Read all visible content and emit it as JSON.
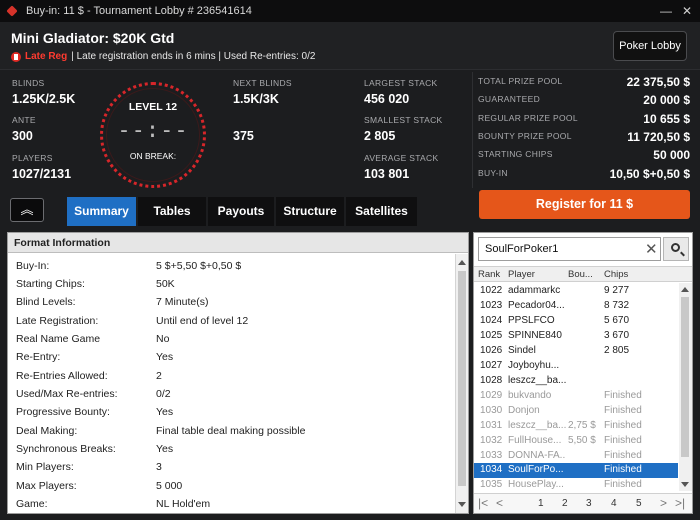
{
  "window": {
    "title": "Buy-in: 11 $ - Tournament Lobby # 236541614",
    "minimize_glyph": "—",
    "close_glyph": "✕"
  },
  "header": {
    "tournament_name": "Mini Gladiator: $20K Gtd",
    "late_reg_label": "Late Reg",
    "late_reg_info": "| Late registration ends in 6 mins | Used Re-entries: 0/2",
    "poker_lobby_label": "Poker Lobby"
  },
  "stats": {
    "blinds_label": "BLINDS",
    "blinds_value": "1.25K/2.5K",
    "ante_label": "ANTE",
    "ante_value": "300",
    "players_label": "PLAYERS",
    "players_value": "1027/2131",
    "clock_level": "LEVEL 12",
    "clock_time": "--:--",
    "clock_status": "ON BREAK:",
    "next_blinds_label": "NEXT BLINDS",
    "next_blinds_value": "1.5K/3K",
    "next_ante_value": "375",
    "largest_stack_label": "LARGEST STACK",
    "largest_stack_value": "456 020",
    "smallest_stack_label": "SMALLEST STACK",
    "smallest_stack_value": "2 805",
    "average_stack_label": "AVERAGE STACK",
    "average_stack_value": "103 801"
  },
  "prize": [
    {
      "label": "TOTAL PRIZE POOL",
      "value": "22 375,50 $"
    },
    {
      "label": "GUARANTEED",
      "value": "20 000 $"
    },
    {
      "label": "REGULAR PRIZE POOL",
      "value": "10 655 $"
    },
    {
      "label": "BOUNTY PRIZE POOL",
      "value": "11 720,50 $"
    },
    {
      "label": "STARTING CHIPS",
      "value": "50 000"
    },
    {
      "label": "BUY-IN",
      "value": "10,50 $+0,50 $"
    }
  ],
  "tabs": [
    "Summary",
    "Tables",
    "Payouts",
    "Structure",
    "Satellites"
  ],
  "register_label": "Register for  11 $",
  "collapse_glyph": "︽",
  "format": {
    "header": "Format Information",
    "rows": [
      {
        "k": "Buy-In:",
        "v": "5 $+5,50 $+0,50 $"
      },
      {
        "k": "Starting Chips:",
        "v": "50K"
      },
      {
        "k": "Blind Levels:",
        "v": "7 Minute(s)"
      },
      {
        "k": "Late Registration:",
        "v": "Until end of level 12"
      },
      {
        "k": "Real Name Game",
        "v": "No"
      },
      {
        "k": "Re-Entry:",
        "v": "Yes"
      },
      {
        "k": "Re-Entries Allowed:",
        "v": "2"
      },
      {
        "k": "Used/Max Re-entries:",
        "v": "0/2"
      },
      {
        "k": "Progressive Bounty:",
        "v": "Yes"
      },
      {
        "k": "Deal Making:",
        "v": "Final table deal making possible"
      },
      {
        "k": "Synchronous Breaks:",
        "v": "Yes"
      },
      {
        "k": "Min Players:",
        "v": "3"
      },
      {
        "k": "Max Players:",
        "v": "5 000"
      },
      {
        "k": "Game:",
        "v": "NL Hold'em"
      }
    ]
  },
  "players": {
    "search_value": "SoulForPoker1",
    "clear_glyph": "✕",
    "columns": [
      "Rank",
      "Player",
      "Bou...",
      "Chips"
    ],
    "rows": [
      {
        "rank": "1022",
        "player": "adammarkc",
        "bounty": "",
        "chips": "9 277",
        "state": "normal"
      },
      {
        "rank": "1023",
        "player": "Pecador04...",
        "bounty": "",
        "chips": "8 732",
        "state": "normal"
      },
      {
        "rank": "1024",
        "player": "PPSLFCO",
        "bounty": "",
        "chips": "5 670",
        "state": "normal"
      },
      {
        "rank": "1025",
        "player": "SPINNE840",
        "bounty": "",
        "chips": "3 670",
        "state": "normal"
      },
      {
        "rank": "1026",
        "player": "Sindel",
        "bounty": "",
        "chips": "2 805",
        "state": "normal"
      },
      {
        "rank": "1027",
        "player": "Joyboyhu...",
        "bounty": "",
        "chips": "",
        "state": "normal"
      },
      {
        "rank": "1028",
        "player": "leszcz__ba...",
        "bounty": "",
        "chips": "",
        "state": "normal"
      },
      {
        "rank": "1029",
        "player": "bukvando",
        "bounty": "",
        "chips": "Finished",
        "state": "finished"
      },
      {
        "rank": "1030",
        "player": "Donjon",
        "bounty": "",
        "chips": "Finished",
        "state": "finished"
      },
      {
        "rank": "1031",
        "player": "leszcz__ba...",
        "bounty": "2,75 $",
        "chips": "Finished",
        "state": "finished"
      },
      {
        "rank": "1032",
        "player": "FullHouse...",
        "bounty": "5,50 $",
        "chips": "Finished",
        "state": "finished"
      },
      {
        "rank": "1033",
        "player": "DONNA-FA...",
        "bounty": "",
        "chips": "Finished",
        "state": "finished"
      },
      {
        "rank": "1034",
        "player": "SoulForPo...",
        "bounty": "",
        "chips": "Finished",
        "state": "selected"
      },
      {
        "rank": "1035",
        "player": "HousePlay...",
        "bounty": "",
        "chips": "Finished",
        "state": "finished"
      }
    ],
    "pager": {
      "first": "|<",
      "prev": "<",
      "pages": [
        "1",
        "2",
        "3",
        "4",
        "5"
      ],
      "next": ">",
      "last": ">|"
    }
  },
  "colors": {
    "accent_blue": "#1f6fc4",
    "register_orange": "#e5561a",
    "late_reg_red": "#ff3b30",
    "clock_red": "#d7262a"
  }
}
